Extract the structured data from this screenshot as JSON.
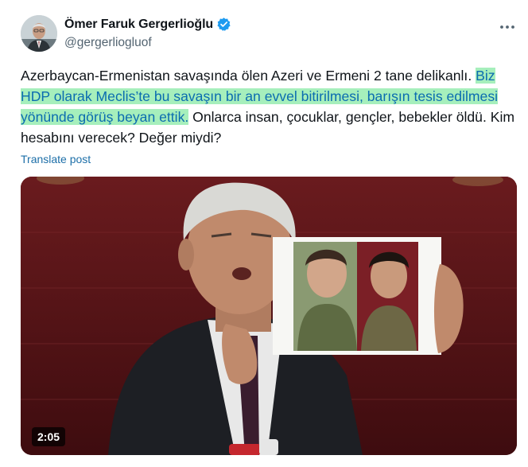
{
  "author": {
    "display_name": "Ömer Faruk Gergerlioğlu",
    "handle": "@gergerliogluof",
    "verified_icon": "verified-badge-icon",
    "avatar_icon": "avatar"
  },
  "more_icon": "more-horizontal-icon",
  "tweet": {
    "part1": "Azerbaycan-Ermenistan savaşında ölen Azeri ve Ermeni 2 tane delikanlı. ",
    "highlight": "Biz HDP olarak Meclis’te bu savaşın bir an evvel bitirilmesi, barışın tesis edilmesi yönünde görüş beyan ettik.",
    "part2": " Onlarca insan, çocuklar, gençler, bebekler öldü. Kim hesabını verecek? Değer miydi?"
  },
  "translate_label": "Translate post",
  "video": {
    "duration": "2:05"
  },
  "colors": {
    "highlight_bg": "#a6efbc",
    "highlight_text": "#0b6cb0",
    "link": "#1d6fa8",
    "verified": "#1d9bf0",
    "backdrop": "#5a1417"
  }
}
